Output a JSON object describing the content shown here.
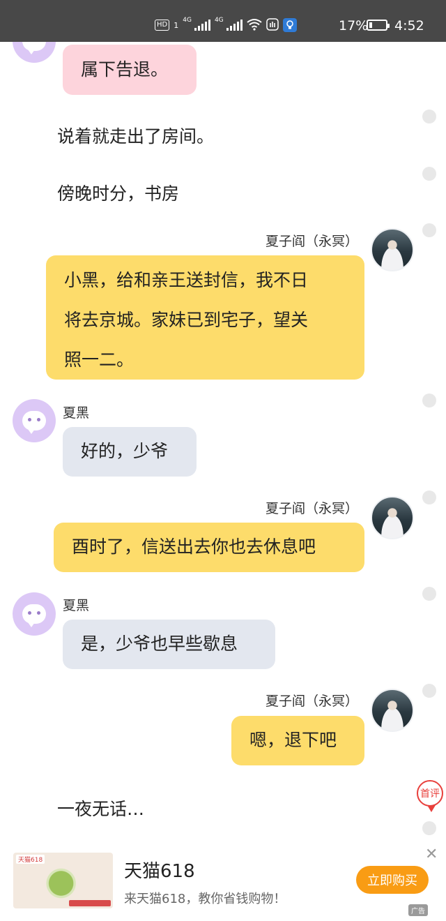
{
  "status_bar": {
    "hd": "HD",
    "sim1": "1",
    "net1": "4G",
    "net2": "4G",
    "battery_pct": "17%",
    "battery_level": 0.17,
    "time": "4:52",
    "icons": [
      "hd-icon",
      "signal-icon",
      "signal-icon",
      "wifi-icon",
      "hand-icon",
      "bulb-icon",
      "battery-icon"
    ]
  },
  "chat": {
    "msg1": "属下告退。",
    "narr1": "说着就走出了房间。",
    "narr2": "傍晚时分，书房",
    "speaker_a": "夏子阎（永冥）",
    "speaker_b": "夏黑",
    "msg2_line1": "小黑，给和亲王送封信，我不日",
    "msg2_line2": "将去京城。家妹已到宅子，望关",
    "msg2_line3": "照一二。",
    "msg3": "好的，少爷",
    "msg4": "酉时了，信送出去你也去休息吧",
    "msg5": "是，少爷也早些歇息",
    "msg6": "嗯，退下吧",
    "narr3": "一夜无话…"
  },
  "first_review": "首评",
  "ad": {
    "title": "天猫618",
    "description": "来天猫618，教你省钱购物！",
    "cta": "立即购买",
    "close": "✕",
    "label": "广告",
    "thumb_tag": "天猫618"
  }
}
